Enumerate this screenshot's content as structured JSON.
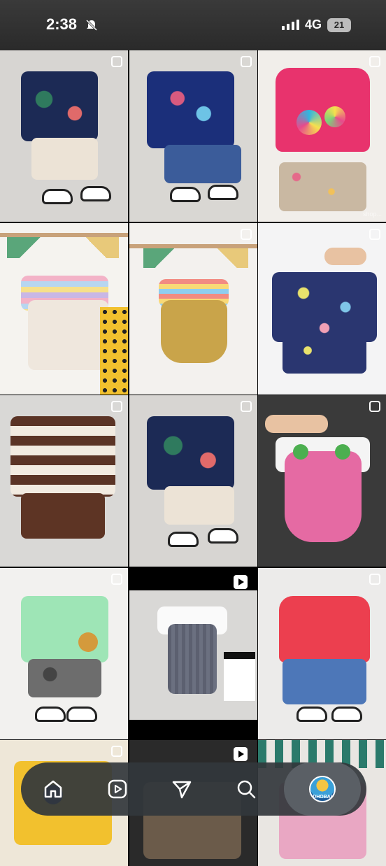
{
  "status_bar": {
    "time": "2:38",
    "network": "4G",
    "battery": "21"
  },
  "avatar_label": "DHOBAI",
  "grid": {
    "tiles": [
      {
        "kind": "post",
        "name": "dino-shirt-set"
      },
      {
        "kind": "post",
        "name": "navy-dino-denim-set"
      },
      {
        "kind": "post",
        "name": "pink-lollipop-set",
        "watermark": "shop..."
      },
      {
        "kind": "post",
        "name": "rainbow-overall-set"
      },
      {
        "kind": "post",
        "name": "cat-overall-set"
      },
      {
        "kind": "post",
        "name": "floral-shirt-set"
      },
      {
        "kind": "post",
        "name": "striped-polo-set"
      },
      {
        "kind": "post",
        "name": "leaf-shirt-set"
      },
      {
        "kind": "post",
        "name": "pink-overall-set"
      },
      {
        "kind": "post",
        "name": "lion-tee-set"
      },
      {
        "kind": "reel",
        "name": "gentleman-vest-set"
      },
      {
        "kind": "post",
        "name": "red-ruffle-denim-set"
      }
    ]
  },
  "nav": {
    "items": [
      "home-icon",
      "reels-icon",
      "share-icon",
      "search-icon",
      "profile-avatar"
    ]
  },
  "colors": {
    "nav_bg": "#32373c",
    "accent_pink": "#e8336d"
  }
}
